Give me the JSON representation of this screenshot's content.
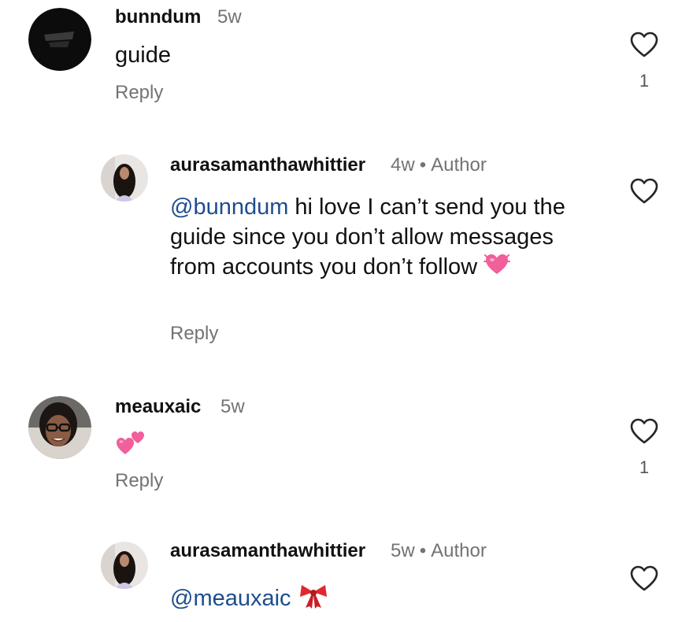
{
  "comments": [
    {
      "username": "bunndum",
      "time": "5w",
      "text": "guide",
      "reply_label": "Reply",
      "likes": "1"
    },
    {
      "username": "aurasamanthawhittier",
      "time": "4w",
      "badge": "Author",
      "mention": "@bunndum",
      "text": " hi love I can’t send you the guide since you don’t allow messages from accounts you don’t follow",
      "emoji": "heart-with-ribbon-emoji",
      "reply_label": "Reply"
    },
    {
      "username": "meauxaic",
      "time": "5w",
      "emoji": "two-hearts-emoji",
      "reply_label": "Reply",
      "likes": "1"
    },
    {
      "username": "aurasamanthawhittier",
      "time": "5w",
      "badge": "Author",
      "mention": "@meauxaic",
      "emoji": "ribbon-emoji"
    }
  ],
  "colors": {
    "mention": "#1e4d8c",
    "secondary_text": "#737373",
    "heart_outline": "#262626"
  }
}
